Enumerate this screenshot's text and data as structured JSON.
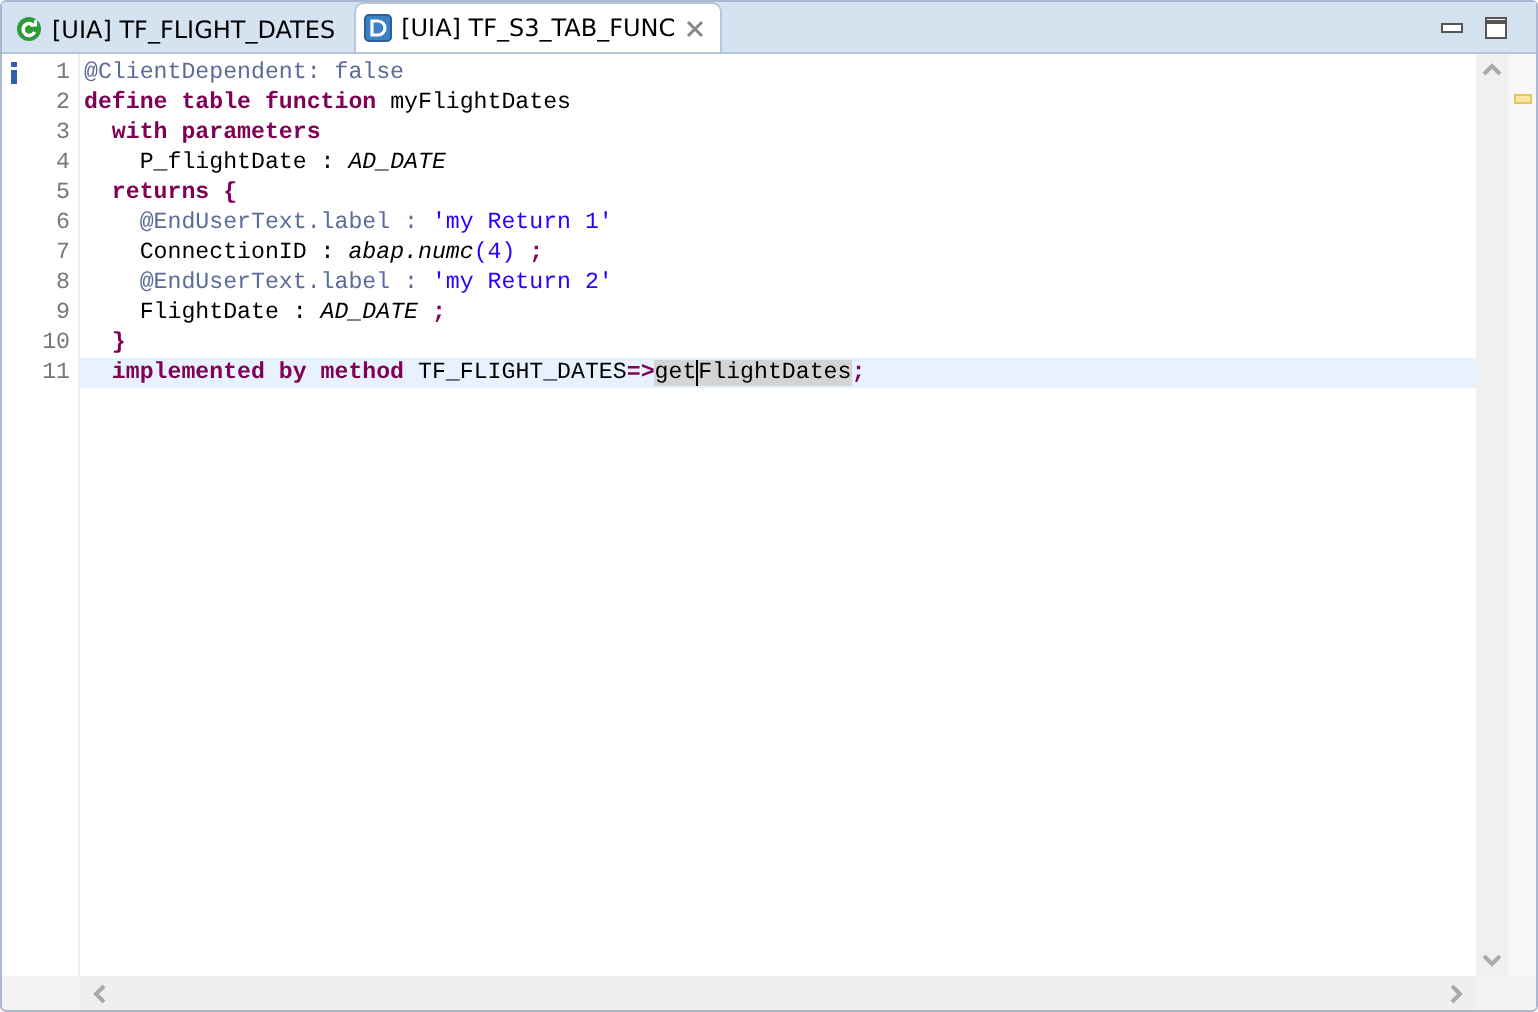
{
  "tabs": [
    {
      "label": "[UIA] TF_FLIGHT_DATES",
      "kind": "green",
      "selected": false,
      "closable": false
    },
    {
      "label": "[UIA] TF_S3_TAB_FUNC",
      "kind": "ddl",
      "selected": true,
      "closable": true
    }
  ],
  "editor": {
    "lines": [
      {
        "number": "1",
        "info": true,
        "current": false,
        "tokens": [
          {
            "t": "@ClientDependent: false",
            "kind": "ann"
          }
        ]
      },
      {
        "number": "2",
        "info": false,
        "current": false,
        "tokens": [
          {
            "t": "define table function",
            "kind": "kw"
          },
          {
            "t": " myFlightDates",
            "kind": "plain"
          }
        ]
      },
      {
        "number": "3",
        "info": false,
        "current": false,
        "tokens": [
          {
            "t": "  with parameters",
            "kind": "kw"
          }
        ]
      },
      {
        "number": "4",
        "info": false,
        "current": false,
        "tokens": [
          {
            "t": "    P_flightDate : ",
            "kind": "plain"
          },
          {
            "t": "AD_DATE",
            "kind": "type"
          }
        ]
      },
      {
        "number": "5",
        "info": false,
        "current": false,
        "tokens": [
          {
            "t": "  returns {",
            "kind": "kw"
          }
        ]
      },
      {
        "number": "6",
        "info": false,
        "current": false,
        "tokens": [
          {
            "t": "    @EndUserText.label : ",
            "kind": "ann"
          },
          {
            "t": "'my Return 1'",
            "kind": "str"
          }
        ]
      },
      {
        "number": "7",
        "info": false,
        "current": false,
        "tokens": [
          {
            "t": "    ConnectionID : ",
            "kind": "plain"
          },
          {
            "t": "abap.numc",
            "kind": "type"
          },
          {
            "t": "(4)",
            "kind": "str"
          },
          {
            "t": " ;",
            "kind": "kw"
          }
        ]
      },
      {
        "number": "8",
        "info": false,
        "current": false,
        "tokens": [
          {
            "t": "    @EndUserText.label : ",
            "kind": "ann"
          },
          {
            "t": "'my Return 2'",
            "kind": "str"
          }
        ]
      },
      {
        "number": "9",
        "info": false,
        "current": false,
        "tokens": [
          {
            "t": "    FlightDate : ",
            "kind": "plain"
          },
          {
            "t": "AD_DATE",
            "kind": "type"
          },
          {
            "t": " ;",
            "kind": "kw"
          }
        ]
      },
      {
        "number": "10",
        "info": false,
        "current": false,
        "tokens": [
          {
            "t": "  }",
            "kind": "kw"
          }
        ]
      },
      {
        "number": "11",
        "info": false,
        "current": true,
        "tokens": [
          {
            "t": "  implemented by method",
            "kind": "kw"
          },
          {
            "t": " TF_FLIGHT_DATES",
            "kind": "plain"
          },
          {
            "t": "=>",
            "kind": "kw"
          },
          {
            "t": "get",
            "kind": "plain",
            "selected": true,
            "caret_after": true
          },
          {
            "t": "FlightDates",
            "kind": "plain",
            "selected": true
          },
          {
            "t": ";",
            "kind": "kw"
          }
        ]
      }
    ]
  }
}
